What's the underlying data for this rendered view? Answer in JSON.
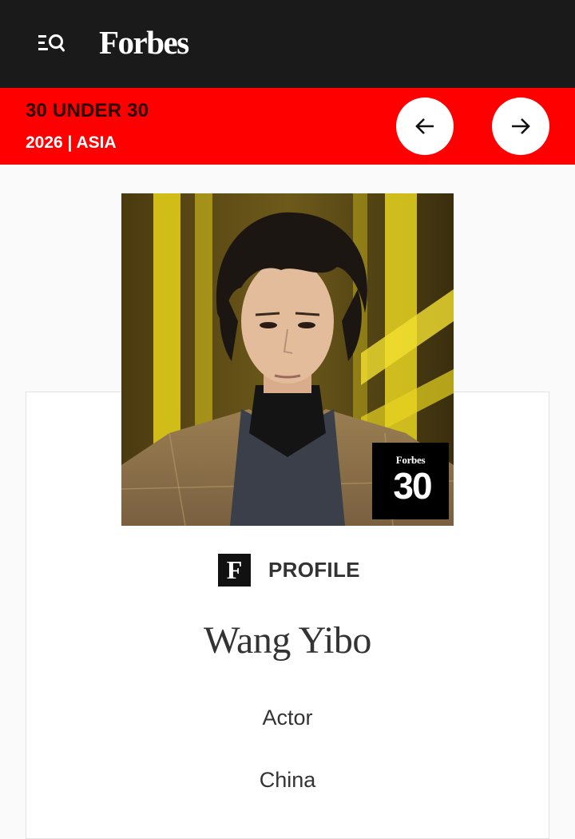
{
  "header": {
    "logo": "Forbes",
    "menu_icon": "menu-search-icon"
  },
  "list_banner": {
    "title": "30 UNDER 30",
    "subtitle": "2026 | ASIA",
    "prev_icon": "arrow-left-icon",
    "next_icon": "arrow-right-icon",
    "background_color": "#fe0000"
  },
  "profile": {
    "badge": {
      "brand": "Forbes",
      "number": "30"
    },
    "section_label": "PROFILE",
    "name": "Wang Yibo",
    "category": "Actor",
    "country": "China"
  }
}
